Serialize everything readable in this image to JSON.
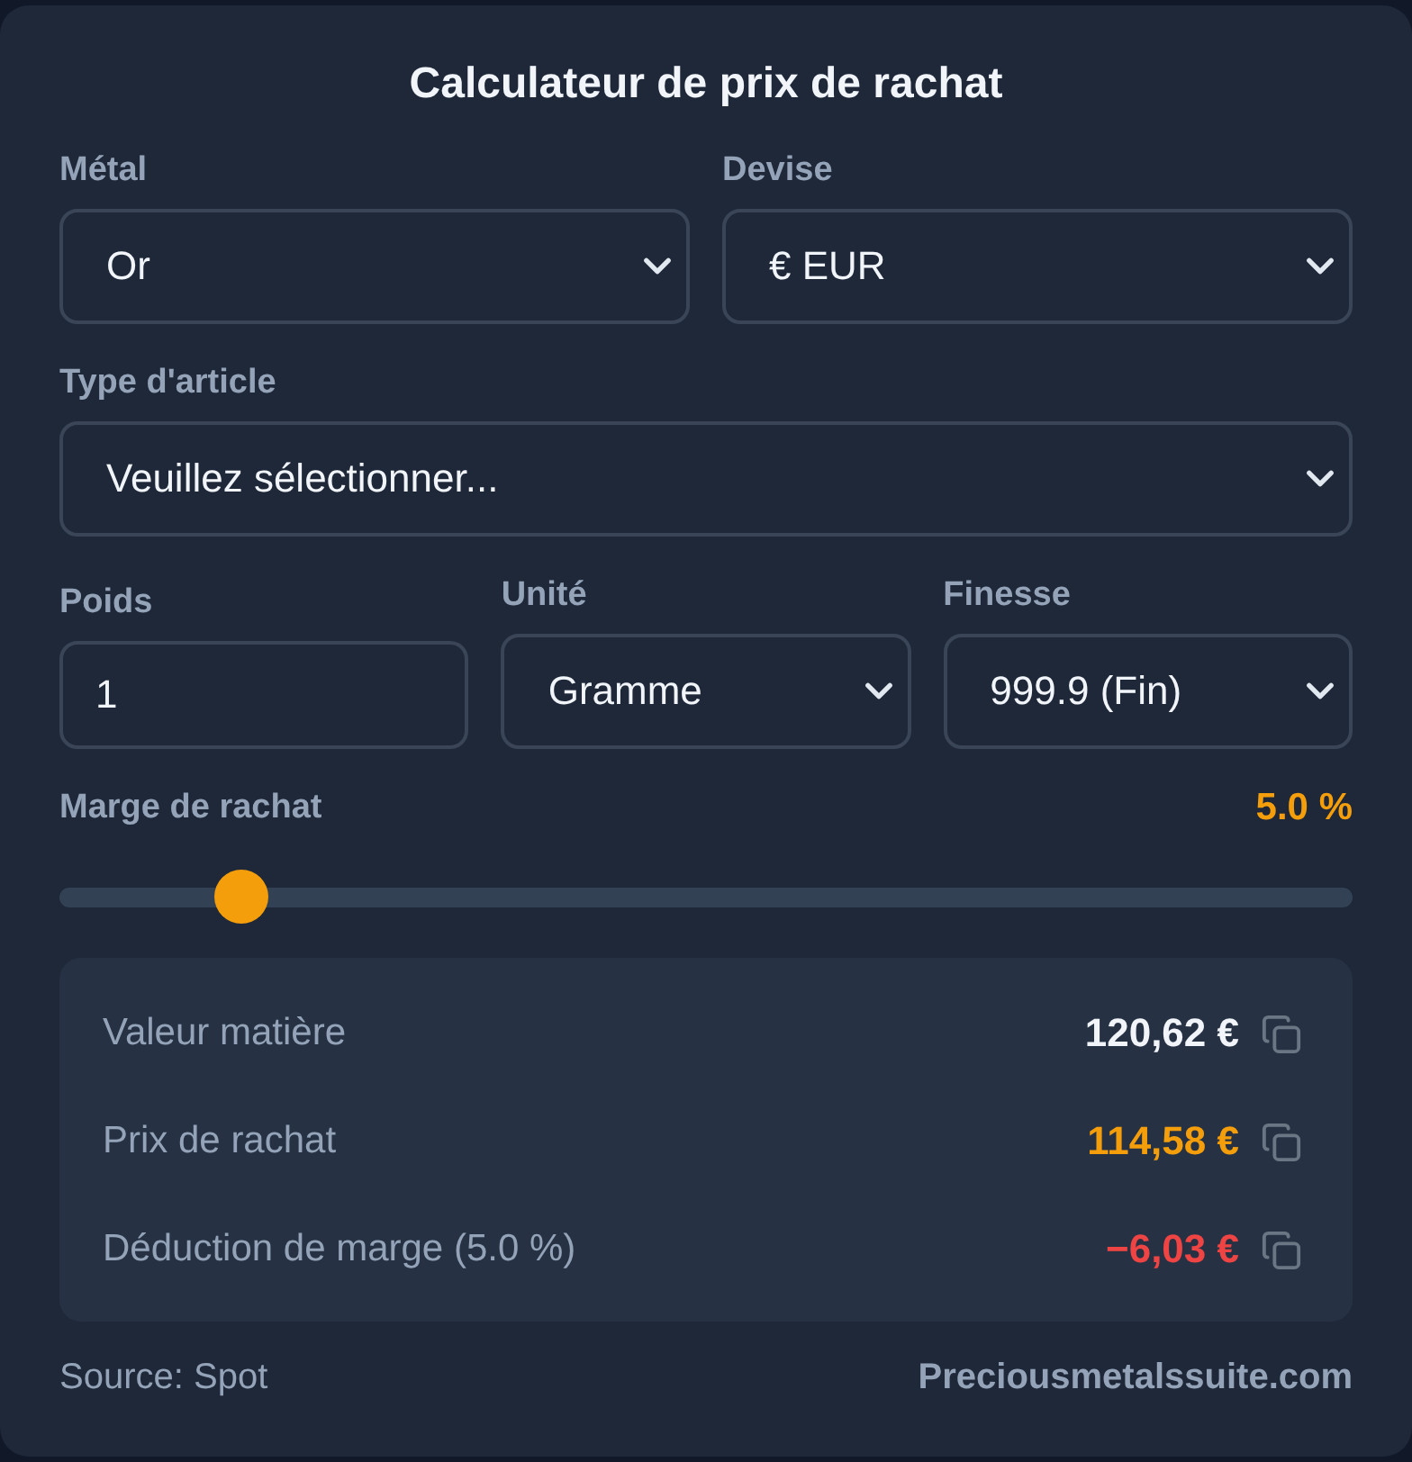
{
  "title": "Calculateur de prix de rachat",
  "field_rows": [
    [
      {
        "kind": "select",
        "label": "Métal",
        "value": "Or"
      },
      {
        "kind": "select",
        "label": "Devise",
        "value": "€ EUR"
      }
    ],
    [
      {
        "kind": "select",
        "label": "Type d'article",
        "value": "Veuillez sélectionner..."
      }
    ],
    [
      {
        "kind": "input",
        "label": "Poids",
        "value": "1"
      },
      {
        "kind": "select",
        "label": "Unité",
        "value": "Gramme"
      },
      {
        "kind": "select",
        "label": "Finesse",
        "value": "999.9 (Fin)"
      }
    ]
  ],
  "margin": {
    "label": "Marge de rachat",
    "reading": "5.0 %",
    "level": 0.14
  },
  "results": [
    {
      "label": "Valeur matière",
      "value": "120,62 €",
      "color": "#f1f5f9"
    },
    {
      "label": "Prix de rachat",
      "value": "114,58 €",
      "color": "#f59e0b"
    },
    {
      "label": "Déduction de marge (5.0 %)",
      "value": "−6,03 €",
      "color": "#ef4444"
    }
  ],
  "footer": {
    "source": "Source: Spot",
    "brand": "Preciousmetalssuite.com"
  }
}
